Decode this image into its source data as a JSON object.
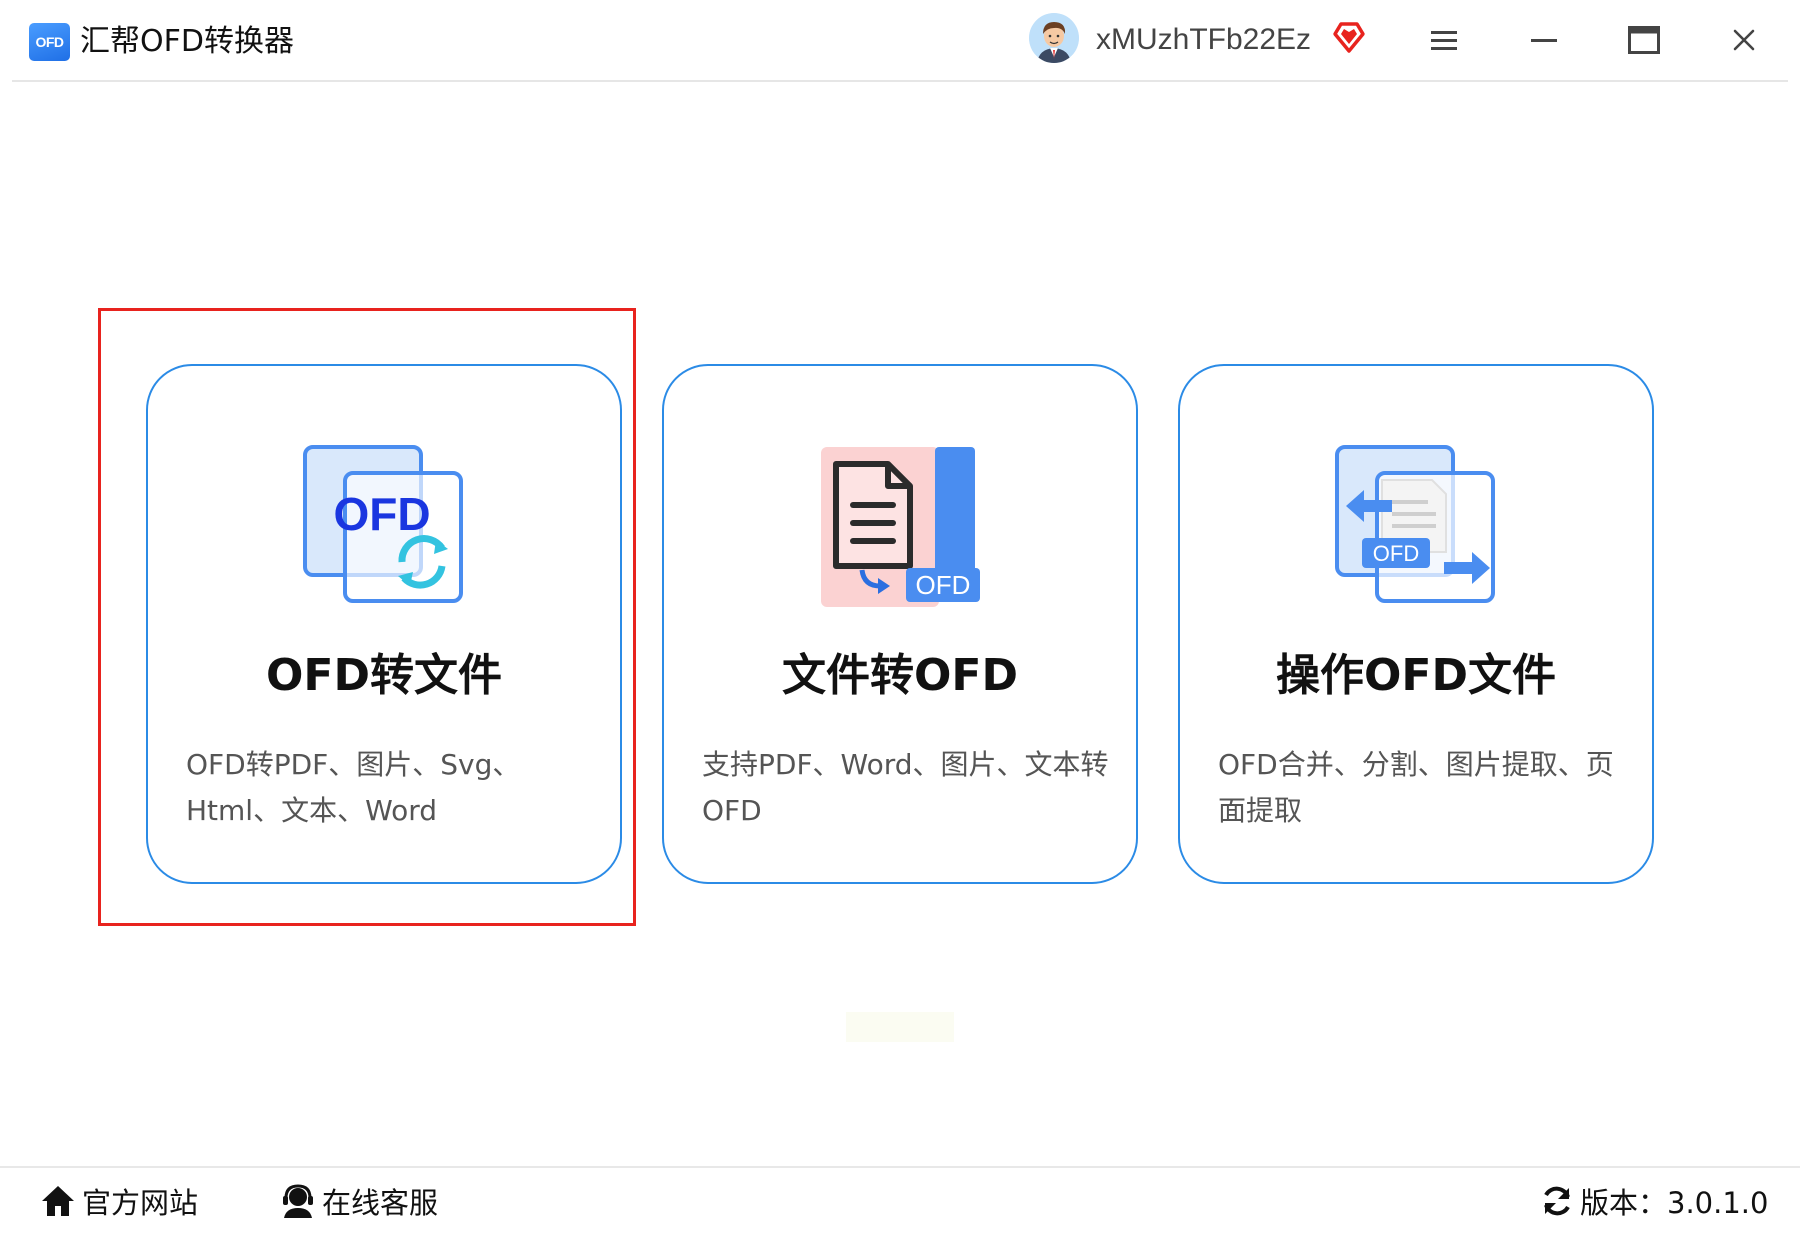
{
  "app": {
    "logo_text": "OFD",
    "title": "汇帮OFD转换器"
  },
  "user": {
    "name": "xMUzhTFb22Ez",
    "vip_icon": "diamond-heart-icon",
    "vip_color": "#e8231e"
  },
  "window_controls": {
    "menu_icon": "hamburger-menu-icon",
    "minimize_icon": "minimize-icon",
    "maximize_icon": "maximize-icon",
    "close_icon": "close-icon"
  },
  "cards": [
    {
      "title": "OFD转文件",
      "desc": "OFD转PDF、图片、Svg、Html、文本、Word",
      "icon": "ofd-convert-icon",
      "icon_text": "OFD"
    },
    {
      "title": "文件转OFD",
      "desc": "支持PDF、Word、图片、文本转OFD",
      "icon": "document-to-ofd-icon",
      "icon_text": "OFD"
    },
    {
      "title": "操作OFD文件",
      "desc": "OFD合并、分割、图片提取、页面提取",
      "icon": "ofd-operate-icon",
      "icon_text": "OFD"
    }
  ],
  "footer": {
    "website_label": "官方网站",
    "website_icon": "home-icon",
    "service_label": "在线客服",
    "service_icon": "headset-user-icon",
    "version_label": "版本：3.0.1.0",
    "version_icon": "refresh-icon"
  },
  "colors": {
    "accent": "#2b8be6",
    "highlight": "#e8231e"
  }
}
